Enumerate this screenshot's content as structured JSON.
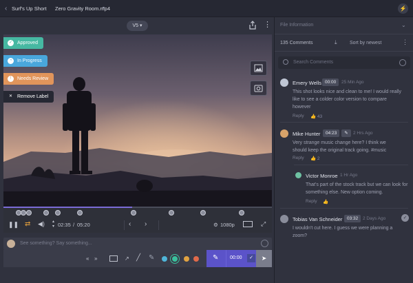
{
  "topbar": {
    "project": "Surf's Up Short",
    "file": "Zero Gravity Room.mp4",
    "caret": "▾",
    "bolt_icon": "⚡"
  },
  "video_toolbar": {
    "version": "V5 ▾"
  },
  "labels": [
    {
      "text": "Approved",
      "icon": "✓",
      "color": "#46b8a2"
    },
    {
      "text": "In Progress",
      "icon": "◔",
      "color": "#49a7dc"
    },
    {
      "text": "Needs Review",
      "icon": "!",
      "color": "#e1955b"
    },
    {
      "text": "Remove Label",
      "icon": "✕",
      "color": "#262833"
    }
  ],
  "player": {
    "progress": 0.48,
    "time_current": "02:35",
    "time_total": "05:20",
    "time_separator": "/",
    "quality": "1080p"
  },
  "composer": {
    "placeholder": "See something? Say something...",
    "timecode": "00:00",
    "nav_left": "«",
    "nav_right": "»"
  },
  "panel": {
    "title": "File Information",
    "comment_count": "135 Comments",
    "sort": "Sort by newest",
    "search_placeholder": "Search Comments"
  },
  "comments": [
    {
      "name": "Emery Wells",
      "timecode": "00:00",
      "date": "25 Min Ago",
      "lines": [
        "This shot looks nice and clean to me! I would really",
        "like to see a colder color version to compare",
        "however"
      ],
      "reply": "Reply",
      "likes": "43",
      "avatar_color": "#bfc6d4"
    },
    {
      "name": "Mike Hunter",
      "timecode": "04:23",
      "date": "2 Hrs Ago",
      "lines": [
        "Very strange music change here? I think we",
        "should keep the original track going. #music"
      ],
      "reply": "Reply",
      "likes": "2",
      "avatar_color": "#d8a36a"
    },
    {
      "name": "Victor Monroe",
      "timecode": "",
      "date": "1 Hr Ago",
      "lines": [
        "That's part of the stock track but we can look for",
        "something else. New option coming."
      ],
      "reply": "Reply",
      "likes": "",
      "avatar_color": "#6ec1a2"
    },
    {
      "name": "Tobias Van Schneider",
      "timecode": "03:32",
      "date": "2 Days Ago",
      "lines": [
        "I wouldn't cut here. I guess we were planning a",
        "zoom?"
      ],
      "reply": "",
      "likes": "",
      "avatar_color": "#8a8d9b"
    }
  ]
}
